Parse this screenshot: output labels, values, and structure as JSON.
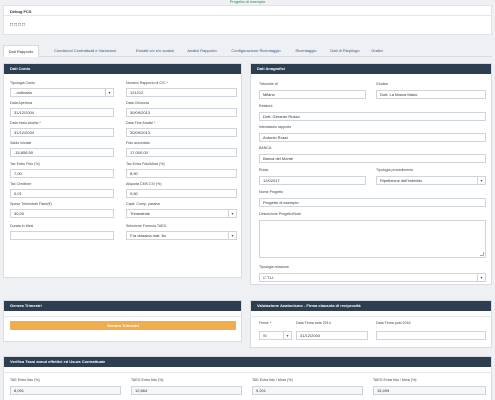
{
  "top_link": "Progetto di esempio",
  "debug": {
    "title": "Debug FCS",
    "value": "□□□□"
  },
  "tabs": [
    {
      "label": "Dati Rapporto"
    },
    {
      "label": "Condizioni Contrattuali e Variazioni"
    },
    {
      "label": "Estratti c/c e/o scalari"
    },
    {
      "label": "Analisi Rapporto"
    },
    {
      "label": "Configurazione Ricentaggio"
    },
    {
      "label": "Ricentaggio"
    },
    {
      "label": "Dati di Riepilogo"
    },
    {
      "label": "Grafici"
    }
  ],
  "conto": {
    "title": "Dati Conto",
    "tipologia_label": "Tipologia Conto",
    "tipologia_value": "- ordinario",
    "numero_label": "Numero Rapporto di C/C *",
    "numero_value": "121212",
    "apertura_label": "Data Apertura",
    "apertura_value": "31/12/2004",
    "chiusura_label": "Data Chiusura",
    "chiusura_value": "30/09/2013",
    "inizio_label": "Data Inizio Analisi *",
    "inizio_value": "31/12/2004",
    "fine_label": "Data Fine Analisi *",
    "fine_value": "30/09/2013",
    "saldo_label": "Saldo Iniziale",
    "saldo_value": "-15.858,50",
    "fido_label": "Fido accordato",
    "fido_value": "17.000,00",
    "tasso_fido_label": "Tax Entro Fido (%)",
    "tasso_fido_value": "7,00",
    "tasso_extra_label": "Tax Extra Fido/Mora (%)",
    "tasso_extra_value": "8,90",
    "tasso_cred_label": "Tax Creditore",
    "tasso_cred_value": "0,01",
    "cms_label": "Aliquota CMS CIV (%)",
    "cms_value": "0,50",
    "spese_label": "Spese Trimestrali Fisse(€)",
    "spese_value": "30,00",
    "capit_label": "Capit. Comp. passive",
    "capit_value": "Trimestrale",
    "durata_label": "Durata in Mesi",
    "durata_value": "",
    "formula_label": "Selezione Formula TAEG",
    "formula_value": "F.la classica mat. fin."
  },
  "anagrafici": {
    "title": "Dati Anagrafici",
    "tribunale_label": "Tribunale di",
    "tribunale_value": "Milano",
    "giudice_label": "Giudice",
    "giudice_value": "Dott. La Marca Mario",
    "relatore_label": "Relatore",
    "relatore_value": "Dott. Gerardo Russo",
    "intestatario_label": "Intestatario rapporto",
    "intestatario_value": "Antonio Rossi",
    "banca_label": "BANCA",
    "banca_value": "Banca del Monte",
    "ruolo_label": "Ruolo",
    "ruolo_value": "12/02017",
    "proc_label": "Tipologia procedimento",
    "proc_value": "Ripetizione dell'indebito",
    "nome_label": "Nome Progetto",
    "nome_value": "Progetto di esempio",
    "desc_label": "Descrizione Progetto/Note",
    "tiporel_label": "Tipologia relazione",
    "tiporel_value": "C.T.U."
  },
  "genera": {
    "title": "Genera Trimestri",
    "button": "Genera Trimestri"
  },
  "anatocismo": {
    "title": "Valutazione Anatocismo - Firma clausola di reciprocità",
    "firma_label": "Firma: *",
    "firma_value": "Si",
    "ante_label": "Data Firma ante 2014",
    "ante_value": "31/12/2004",
    "post_label": "Data Firma post 2016",
    "post_value": ""
  },
  "verifica": {
    "title": "Verifica Tassi annui effettivi ed Usura Contrattuale",
    "fields": [
      {
        "label": "TAE Entro fido (%)",
        "value": "8,091"
      },
      {
        "label": "TAEG Entro fido (%)",
        "value": "12,864"
      },
      {
        "label": "TAE Extra fido / Mora (%)",
        "value": "9,201"
      },
      {
        "label": "TAEG Extra fido / Mora (%)",
        "value": "15,499"
      }
    ]
  }
}
